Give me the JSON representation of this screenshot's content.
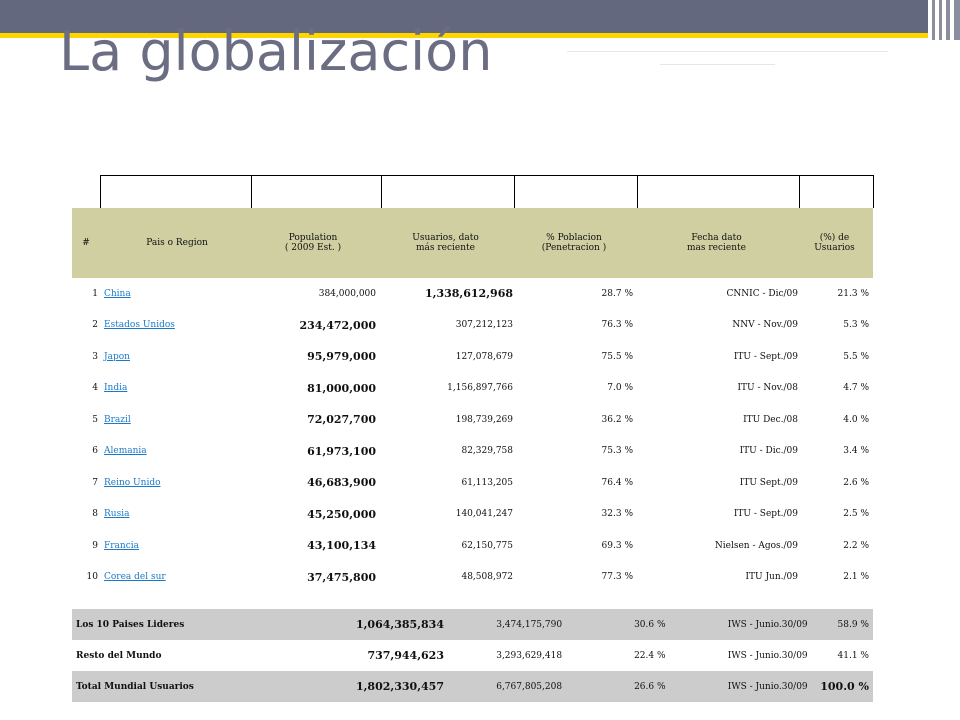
{
  "slide": {
    "title": "La globalización"
  },
  "table": {
    "headers": [
      "#",
      "Pais o Region",
      "Population\n( 2009 Est. )",
      "Usuarios, dato\nmás reciente",
      "% Poblacion\n(Penetracion )",
      "Fecha dato\nmas reciente",
      "(%) de\nUsuarios"
    ],
    "rows": [
      {
        "n": "1",
        "country": "China",
        "population": "384,000,000",
        "users": "1,338,612,968",
        "penetration": "28.7 %",
        "date": "CNNIC - Dic/09",
        "share": "21.3 %"
      },
      {
        "n": "2",
        "country": "Estados Unidos",
        "population": "234,472,000",
        "users": "307,212,123",
        "penetration": "76.3 %",
        "date": "NNV - Nov./09",
        "share": "5.3 %"
      },
      {
        "n": "3",
        "country": "Japon",
        "population": "95,979,000",
        "users": "127,078,679",
        "penetration": "75.5 %",
        "date": "ITU - Sept./09",
        "share": "5.5 %"
      },
      {
        "n": "4",
        "country": "India",
        "population": "81,000,000",
        "users": "1,156,897,766",
        "penetration": "7.0 %",
        "date": "ITU - Nov./08",
        "share": "4.7 %"
      },
      {
        "n": "5",
        "country": "Brazil",
        "population": "72,027,700",
        "users": "198,739,269",
        "penetration": "36.2 %",
        "date": "ITU Dec./08",
        "share": "4.0 %"
      },
      {
        "n": "6",
        "country": "Alemania",
        "population": "61,973,100",
        "users": "82,329,758",
        "penetration": "75.3 %",
        "date": "ITU - Dic./09",
        "share": "3.4 %"
      },
      {
        "n": "7",
        "country": "Reino Unido",
        "population": "46,683,900",
        "users": "61,113,205",
        "penetration": "76.4 %",
        "date": "ITU Sept./09",
        "share": "2.6 %"
      },
      {
        "n": "8",
        "country": "Rusia",
        "population": "45,250,000",
        "users": "140,041,247",
        "penetration": "32.3 %",
        "date": "ITU - Sept./09",
        "share": "2.5 %"
      },
      {
        "n": "9",
        "country": "Francia",
        "population": "43,100,134",
        "users": "62,150,775",
        "penetration": "69.3 %",
        "date": "Nielsen - Agos./09",
        "share": "2.2 %"
      },
      {
        "n": "10",
        "country": "Corea del sur",
        "population": "37,475,800",
        "users": "48,508,972",
        "penetration": "77.3 %",
        "date": "ITU Jun./09",
        "share": "2.1 %"
      }
    ],
    "summary": [
      {
        "label": "Los 10 Paises Lideres",
        "population": "1,064,385,834",
        "users": "3,474,175,790",
        "penetration": "30.6 %",
        "date": "IWS - Junio.30/09",
        "share": "58.9 %"
      },
      {
        "label": "Resto del Mundo",
        "population": "737,944,623",
        "users": "3,293,629,418",
        "penetration": "22.4 %",
        "date": "IWS - Junio.30/09",
        "share": "41.1 %"
      },
      {
        "label": "Total Mundial Usuarios",
        "population": "1,802,330,457",
        "users": "6,767,805,208",
        "penetration": "26.6 %",
        "date": "IWS - Junio.30/09",
        "share": "100.0 %"
      }
    ]
  }
}
